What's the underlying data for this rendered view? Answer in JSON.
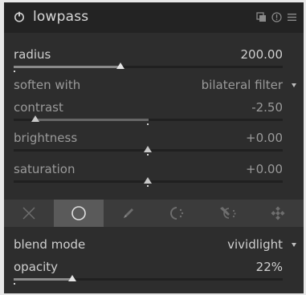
{
  "module": {
    "title": "lowpass"
  },
  "header_icons": [
    "power-icon",
    "presets-icon",
    "reset-icon",
    "menu-icon"
  ],
  "params": {
    "radius": {
      "label": "radius",
      "value": "200.00",
      "level": 0.4
    },
    "soften_with": {
      "label": "soften with",
      "value": "bilateral filter"
    },
    "contrast": {
      "label": "contrast",
      "value": "-2.50",
      "level": 0.08
    },
    "brightness": {
      "label": "brightness",
      "value": "+0.00",
      "level": 0.5
    },
    "saturation": {
      "label": "saturation",
      "value": "+0.00",
      "level": 0.5
    }
  },
  "mask_modes": [
    "off-icon",
    "uniform-icon",
    "drawn-icon",
    "parametric-icon",
    "drawn-parametric-icon",
    "raster-icon"
  ],
  "blend": {
    "mode_label": "blend mode",
    "mode_value": "vividlight",
    "opacity_label": "opacity",
    "opacity_value": "22%",
    "opacity_level": 0.22
  },
  "colors": {
    "panel": "#2d2d2d",
    "header": "#232323",
    "text": "#cfcfcf",
    "slider_fill": "#8a8a8a"
  }
}
